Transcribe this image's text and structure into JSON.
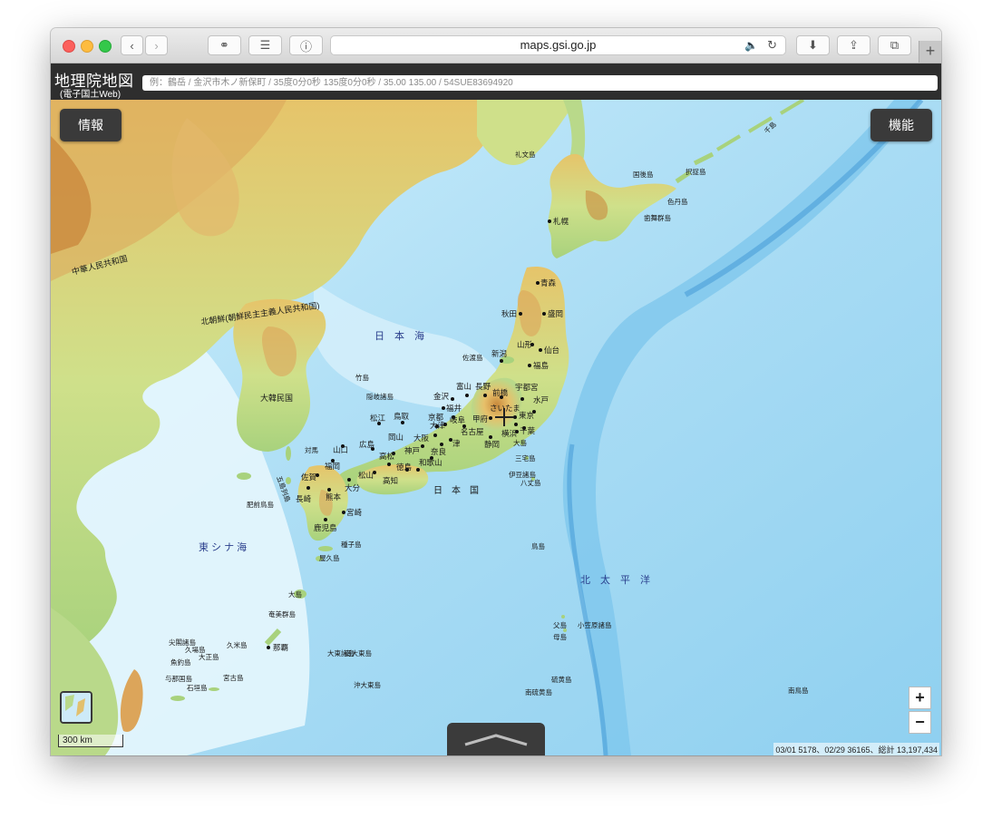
{
  "browser": {
    "url": "maps.gsi.go.jp"
  },
  "header": {
    "title": "地理院地図",
    "subtitle": "(電子国土Web)",
    "search_placeholder": "例：鶴岳 / 金沢市木ノ新保町 / 35度0分0秒 135度0分0秒 / 35.00 135.00 / 54SUE83694920"
  },
  "buttons": {
    "info": "情報",
    "functions": "機能",
    "zoom_in": "+",
    "zoom_out": "−"
  },
  "scale_label": "300 km",
  "counter": "03/01 5178、02/29 36165、総計 13,197,434",
  "map": {
    "seas": [
      "日　本　海",
      "東 シ ナ 海",
      "北　太　平　洋"
    ],
    "countries": [
      "中華人民共和国",
      "北朝鮮(朝鮮民主主義人民共和国)",
      "大韓民国",
      "日　本　国"
    ],
    "cities": [
      "札幌",
      "青森",
      "秋田",
      "盛岡",
      "山形",
      "仙台",
      "新潟",
      "福島",
      "富山",
      "長野",
      "前橋",
      "宇都宮",
      "金沢",
      "水戸",
      "さいたま",
      "福井",
      "岐阜",
      "甲府",
      "東京",
      "京都",
      "大津",
      "名古屋",
      "横浜",
      "千葉",
      "松江",
      "鳥取",
      "大阪",
      "奈良",
      "静岡",
      "山口",
      "広島",
      "岡山",
      "神戸",
      "津",
      "福岡",
      "佐賀",
      "高松",
      "徳島",
      "和歌山",
      "大分",
      "松山",
      "高知",
      "長崎",
      "熊本",
      "宮崎",
      "鹿児島",
      "那覇"
    ],
    "islands": [
      "礼文島",
      "国後島",
      "択捉島",
      "色丹島",
      "歯舞群島",
      "佐渡島",
      "竹島",
      "隠岐諸島",
      "対馬",
      "五島列島",
      "肥前鳥島",
      "大島",
      "三宅島",
      "八丈島",
      "伊豆諸島",
      "鳥島",
      "種子島",
      "屋久島",
      "大島",
      "奄美群島",
      "尖閣諸島",
      "久場島",
      "大正島",
      "魚釣島",
      "与那国島",
      "石垣島",
      "宮古島",
      "久米島",
      "大東諸島",
      "南大東島",
      "沖大東島",
      "父島",
      "母島",
      "小笠原諸島",
      "硫黄島",
      "南硫黄島",
      "南鳥島",
      "千島"
    ]
  }
}
